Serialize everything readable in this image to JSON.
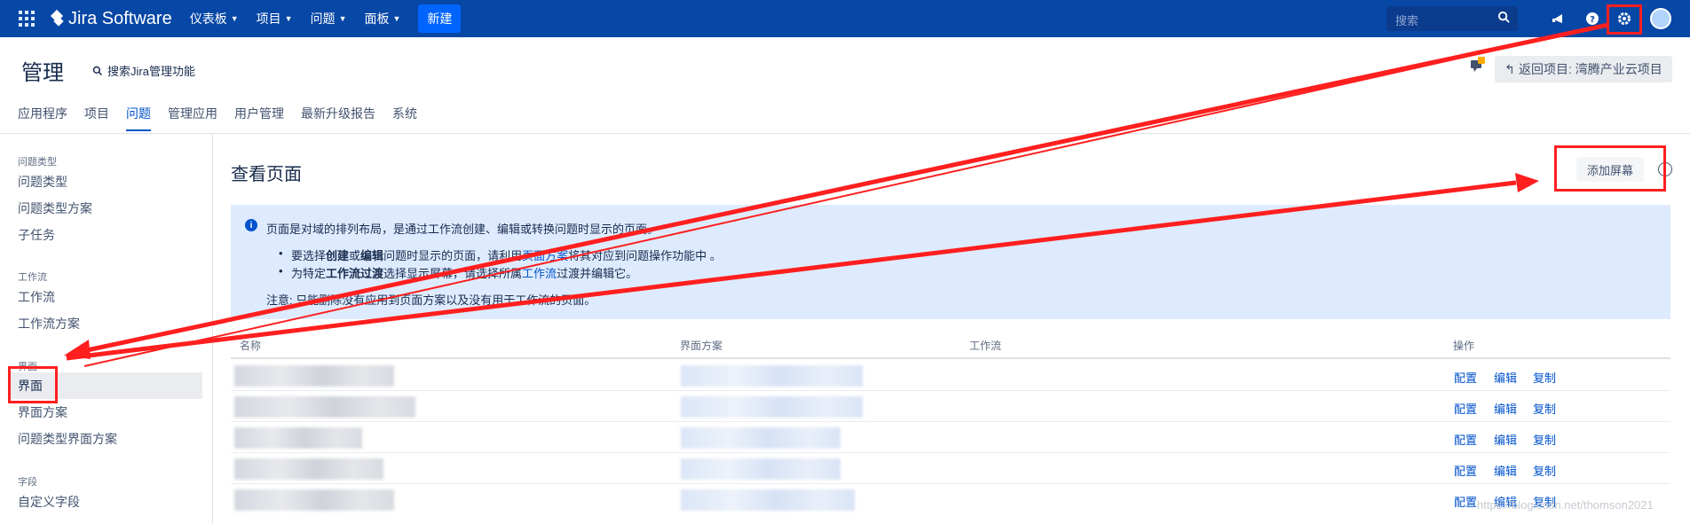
{
  "topnav": {
    "brand": "Jira Software",
    "menus": [
      "仪表板",
      "项目",
      "问题",
      "面板"
    ],
    "create_label": "新建",
    "search_placeholder": "搜索"
  },
  "header": {
    "title": "管理",
    "admin_search": "搜索Jira管理功能",
    "back_button": "返回项目: 湾腾产业云项目"
  },
  "tabs": [
    "应用程序",
    "项目",
    "问题",
    "管理应用",
    "用户管理",
    "最新升级报告",
    "系统"
  ],
  "sidebar": {
    "groups": {
      "issue_types": "问题类型",
      "workflows": "工作流",
      "screens": "界面",
      "fields": "字段"
    },
    "items": {
      "issue_types": "问题类型",
      "issue_type_schemes": "问题类型方案",
      "subtasks": "子任务",
      "workflows": "工作流",
      "workflow_schemes": "工作流方案",
      "screens": "界面",
      "screen_schemes": "界面方案",
      "issue_type_screen_schemes": "问题类型界面方案",
      "custom_fields": "自定义字段"
    }
  },
  "main": {
    "title": "查看页面",
    "add_button": "添加屏幕",
    "info": {
      "intro": "页面是对域的排列布局，是通过工作流创建、编辑或转换问题时显示的页面。",
      "b1_a": "要选择",
      "b1_b": "创建",
      "b1_c": "或",
      "b1_d": "编辑",
      "b1_e": "问题时显示的页面，请利用",
      "b1_link": "页面方案",
      "b1_f": "将其对应到问题操作功能中 。",
      "b2_a": "为特定",
      "b2_b": "工作流过渡",
      "b2_c": "选择显示屏幕，请选择所属",
      "b2_link": "工作流",
      "b2_d": "过渡并编辑它。",
      "note": "注意: 只能删除没有应用到页面方案以及没有用于工作流的页面。"
    },
    "table": {
      "headers": [
        "名称",
        "界面方案",
        "工作流",
        "操作"
      ],
      "row_actions": [
        "配置",
        "编辑",
        "复制"
      ]
    }
  },
  "watermark": "https://blog.csdn.net/thomson2021",
  "colors": {
    "nav": "#0747a6",
    "accent": "#0052cc",
    "info_bg": "#deebff",
    "annotation": "#ff1f1f"
  }
}
